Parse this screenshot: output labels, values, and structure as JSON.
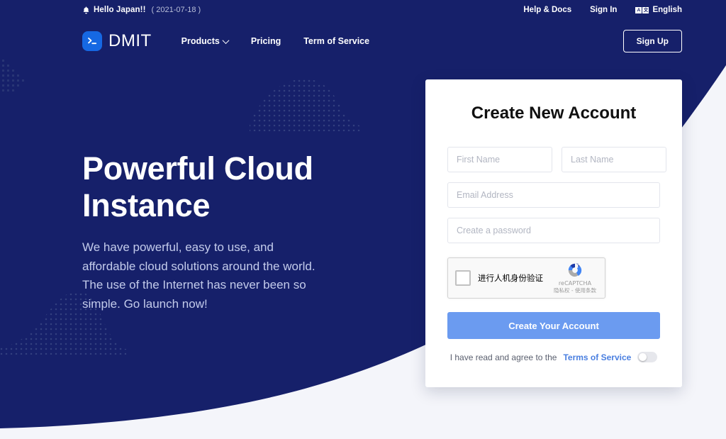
{
  "topbar": {
    "bell_icon": "bell-icon",
    "hello": "Hello Japan!!",
    "date": "( 2021-07-18 )",
    "help": "Help & Docs",
    "signin": "Sign In",
    "lang_a": "A",
    "lang_b": "文",
    "language": "English"
  },
  "nav": {
    "logo_glyph": ">_",
    "logo_text": "DMIT",
    "items": [
      {
        "label": "Products",
        "has_caret": true
      },
      {
        "label": "Pricing",
        "has_caret": false
      },
      {
        "label": "Term of Service",
        "has_caret": false
      }
    ],
    "signup_label": "Sign Up"
  },
  "hero": {
    "title_line1": "Powerful Cloud",
    "title_line2": "Instance",
    "subtitle": "We have powerful, easy to use, and affordable cloud solutions around the world. The use of the Internet has never been so simple. Go launch now!"
  },
  "card": {
    "title": "Create New Account",
    "first_name_placeholder": "First Name",
    "last_name_placeholder": "Last Name",
    "email_placeholder": "Email Address",
    "password_placeholder": "Create a password",
    "first_name_value": "",
    "last_name_value": "",
    "email_value": "",
    "password_value": "",
    "recaptcha": {
      "label": "进行人机身份验证",
      "brand": "reCAPTCHA",
      "terms": "隐私权 - 使用条款"
    },
    "submit_label": "Create Your Account",
    "terms_text": "I have read and agree to the",
    "terms_link": "Terms of Service",
    "toggle_state": "off"
  },
  "colors": {
    "navy": "#16206a",
    "page_bg": "#f4f5fa",
    "accent_blue": "#6b9bf0",
    "logo_blue": "#1668e3",
    "link_blue": "#4a7fe0",
    "hero_sub": "#c3cbeb"
  }
}
